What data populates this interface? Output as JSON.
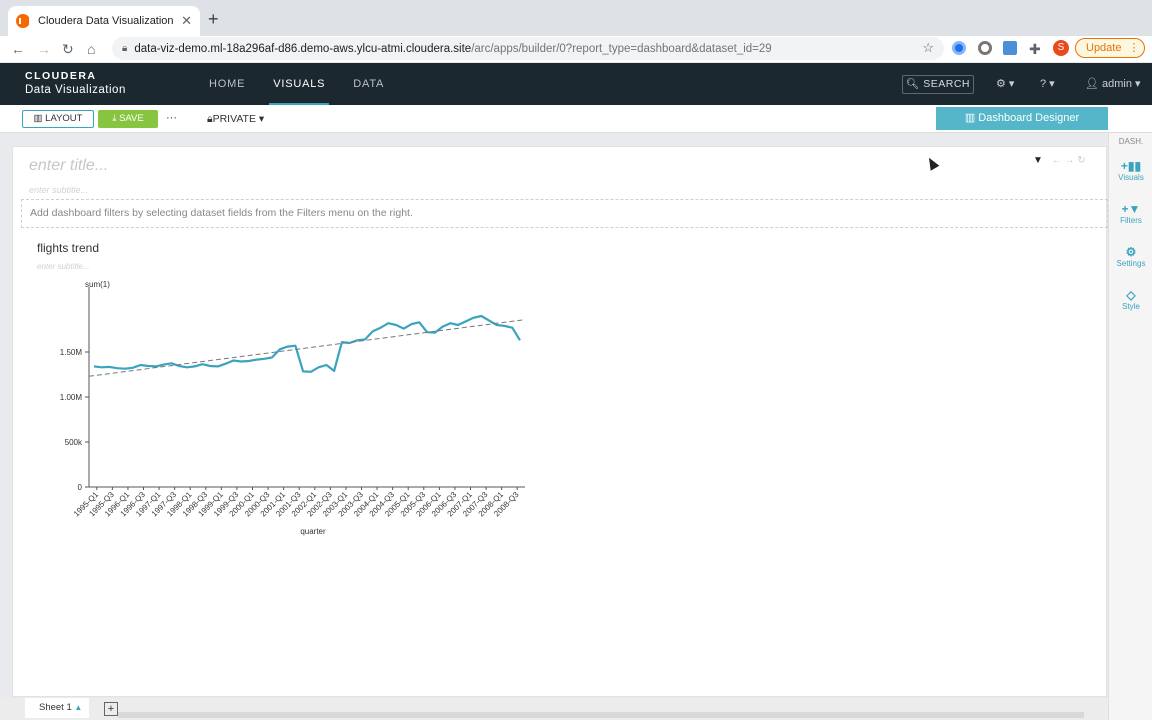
{
  "browser": {
    "tab_title": "Cloudera Data Visualization",
    "url_host": "data-viz-demo.ml-18a296af-d86.demo-aws.ylcu-atmi.cloudera.site",
    "url_path": "/arc/apps/builder/0?report_type=dashboard&dataset_id=29",
    "profile_initial": "S",
    "update_label": "Update"
  },
  "header": {
    "brand_top": "CLOUDERA",
    "brand_bottom": "Data Visualization",
    "nav": [
      "HOME",
      "VISUALS",
      "DATA"
    ],
    "search_label": "SEARCH",
    "user": "admin"
  },
  "toolbar": {
    "layout_label": "LAYOUT",
    "save_label": "SAVE",
    "more_label": "···",
    "privacy_label": "PRIVATE",
    "designer_label": "Dashboard Designer"
  },
  "dashboard": {
    "title_placeholder": "enter title...",
    "subtitle_placeholder": "enter subtitle...",
    "filter_hint": "Add dashboard filters by selecting dataset fields from the Filters menu on the right."
  },
  "visual": {
    "title": "flights trend",
    "subtitle_placeholder": "enter subtitle..."
  },
  "rail": {
    "header": "DASH.",
    "items": [
      "Visuals",
      "Filters",
      "Settings",
      "Style"
    ]
  },
  "sheets": [
    "Sheet 1"
  ],
  "chart_data": {
    "type": "line",
    "title": "",
    "xlabel": "quarter",
    "ylabel": "sum(1)",
    "ylim": [
      0,
      2000000
    ],
    "yticks": [
      "0",
      "500k",
      "1.00M",
      "1.50M"
    ],
    "xtick_labels": [
      "1995-Q1",
      "1995-Q3",
      "1996-Q1",
      "1996-Q3",
      "1997-Q1",
      "1997-Q3",
      "1998-Q1",
      "1998-Q3",
      "1999-Q1",
      "1999-Q3",
      "2000-Q1",
      "2000-Q3",
      "2001-Q1",
      "2001-Q3",
      "2002-Q1",
      "2002-Q3",
      "2003-Q1",
      "2003-Q3",
      "2004-Q1",
      "2004-Q3",
      "2005-Q1",
      "2005-Q3",
      "2006-Q1",
      "2006-Q3",
      "2007-Q1",
      "2007-Q3",
      "2008-Q1",
      "2008-Q3"
    ],
    "series": [
      {
        "values": [
          1340000,
          1330000,
          1335000,
          1320000,
          1315000,
          1325000,
          1355000,
          1345000,
          1340000,
          1360000,
          1375000,
          1345000,
          1330000,
          1340000,
          1365000,
          1345000,
          1340000,
          1370000,
          1405000,
          1395000,
          1400000,
          1415000,
          1425000,
          1440000,
          1530000,
          1560000,
          1570000,
          1285000,
          1280000,
          1330000,
          1355000,
          1290000,
          1610000,
          1600000,
          1630000,
          1640000,
          1730000,
          1770000,
          1820000,
          1800000,
          1760000,
          1810000,
          1830000,
          1720000,
          1715000,
          1780000,
          1820000,
          1800000,
          1840000,
          1880000,
          1900000,
          1850000,
          1800000,
          1790000,
          1770000,
          1630000
        ],
        "color": "#3aa4bf"
      }
    ],
    "trendline": {
      "start": 1230000,
      "end": 1860000,
      "style": "dashed",
      "color": "#777777"
    },
    "grid": false,
    "legend": "none"
  }
}
